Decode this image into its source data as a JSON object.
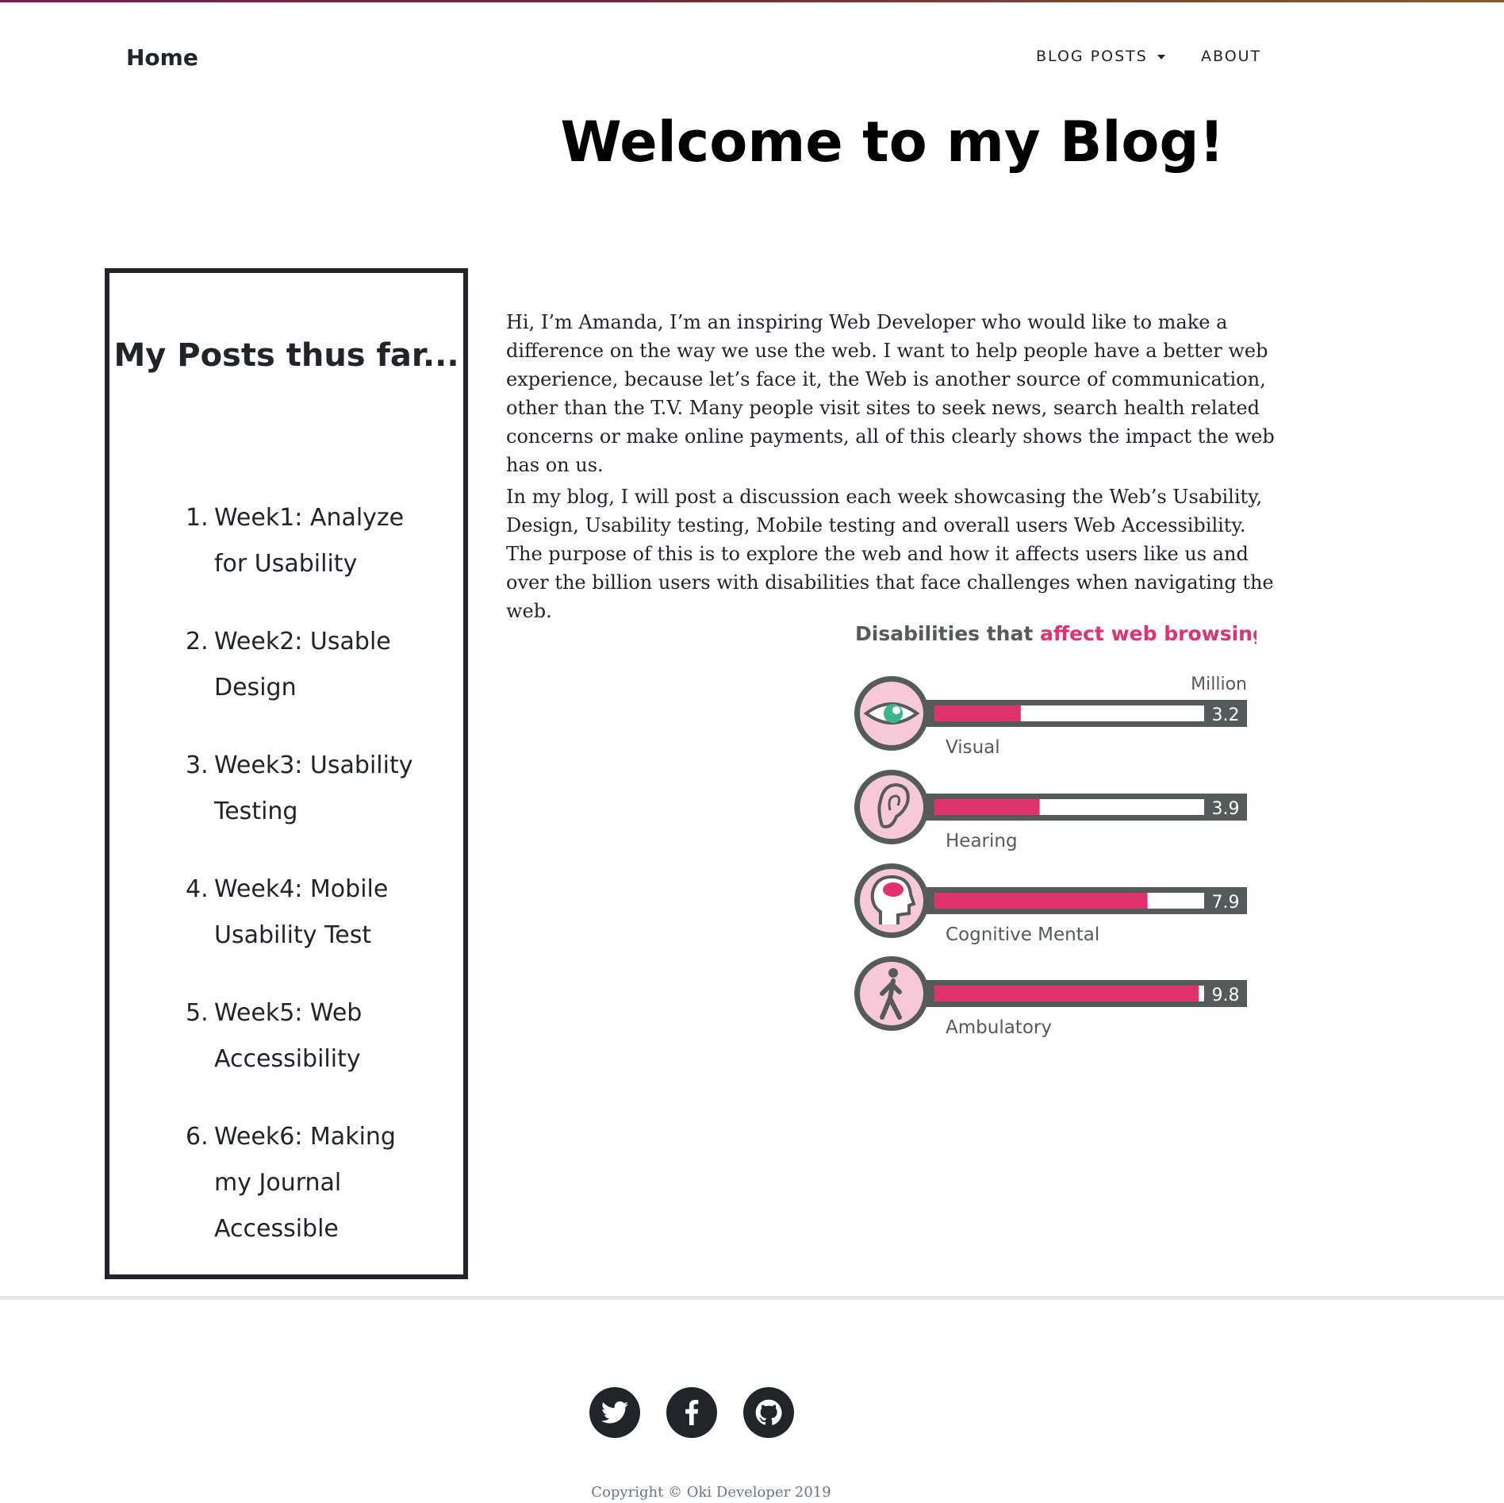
{
  "nav": {
    "home": "Home",
    "blog_posts": "BLOG POSTS",
    "about": "ABOUT"
  },
  "header": {
    "title": "Welcome to my Blog!"
  },
  "sidebar": {
    "title": "My Posts thus far...",
    "posts": [
      {
        "num": "1.",
        "label": "Week1: Analyze for Usability"
      },
      {
        "num": "2.",
        "label": "Week2: Usable Design"
      },
      {
        "num": "3.",
        "label": "Week3: Usability Testing"
      },
      {
        "num": "4.",
        "label": "Week4: Mobile Usability Test"
      },
      {
        "num": "5.",
        "label": "Week5: Web Accessibility"
      },
      {
        "num": "6.",
        "label": "Week6: Making my Journal Accessible"
      }
    ]
  },
  "main": {
    "intro": "Hi, I’m Amanda, I’m an inspiring Web Developer who would like to make a difference on the way we use the web. I want to help people have a better web experience, because let’s face it, the Web is another source of communication, other than the T.V. Many people visit sites to seek news, search health related concerns or make online payments, all of this clearly shows the impact the web has on us.",
    "purpose": "In my blog, I will post a discussion each week showcasing the Web’s Usability, Design, Usability testing, Mobile testing and overall users Web Accessibility. The purpose of this is to explore the web and how it affects users like us and over the billion users with disabilities that face challenges when navigating the web."
  },
  "chart_data": {
    "type": "bar",
    "title": "Disabilities that",
    "title_highlight": "affect web browsing",
    "unit": "Million",
    "categories": [
      "Visual",
      "Hearing",
      "Cognitive Mental",
      "Ambulatory"
    ],
    "values": [
      3.2,
      3.9,
      7.9,
      9.8
    ],
    "ylim": [
      0,
      10
    ],
    "icons": [
      "eye-icon",
      "ear-icon",
      "head-brain-icon",
      "walking-person-icon"
    ],
    "colors": {
      "bar": "#e0336e",
      "track": "#ffffff",
      "frame": "#555a5a",
      "icon_bg": "#f6c8d8",
      "title_accent": "#e0336e"
    }
  },
  "footer": {
    "social": [
      "twitter-icon",
      "facebook-icon",
      "github-icon"
    ],
    "copyright": "Copyright © Oki Developer 2019"
  }
}
